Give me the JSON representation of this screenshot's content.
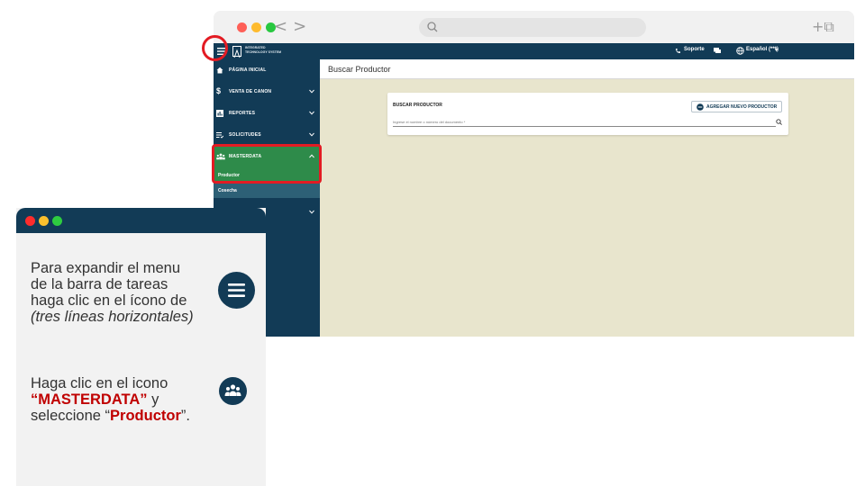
{
  "colors": {
    "sidebar": "#123b56",
    "active_item": "#2e8b4a",
    "submenu": "#2d6076",
    "main_bg": "#e8e5cd",
    "highlight": "#e31b23",
    "emphasis_text": "#c00000"
  },
  "browser": {
    "traffic_lights": [
      "#fe5f57",
      "#febb2e",
      "#28c840"
    ],
    "back_forward_icons": "chevron-left-right-icons",
    "new_tab_icon": "plus-copy-icon"
  },
  "header": {
    "menu_icon": "hamburger-icon",
    "logo_line1": "INTEGRATED",
    "logo_line2": "TECHNOLOGY SYSTEM",
    "support_label": "Soporte",
    "language_label": "Español (***)"
  },
  "sidebar": {
    "items": [
      {
        "label": "PÁGINA INICIAL",
        "icon": "home-icon"
      },
      {
        "label": "VENTA DE CANON",
        "icon": "dollar-icon"
      },
      {
        "label": "REPORTES",
        "icon": "chart-icon"
      },
      {
        "label": "SOLICITUDES",
        "icon": "list-icon"
      },
      {
        "label": "MASTERDATA",
        "icon": "people-icon"
      }
    ],
    "submenu": [
      {
        "label": "Productor"
      },
      {
        "label": "Cosecha"
      }
    ]
  },
  "main": {
    "page_title": "Buscar Productor",
    "card_title": "BUSCAR PRODUCTOR",
    "add_button": "AGREGAR NUEVO PRODUCTOR",
    "search_placeholder": "Ingrese el nombre o número del documento *"
  },
  "instructions": {
    "step1_line1": "Para expandir el menu",
    "step1_line2": "de la barra de tareas",
    "step1_line3": "haga clic en el ícono de",
    "step1_line4": "(tres líneas horizontales)",
    "step2_line1": "Haga clic en el icono",
    "step2_term1": "“MASTERDATA”",
    "step2_after1": " y",
    "step2_before2": "seleccione “",
    "step2_term2": "Productor",
    "step2_end": "”."
  }
}
